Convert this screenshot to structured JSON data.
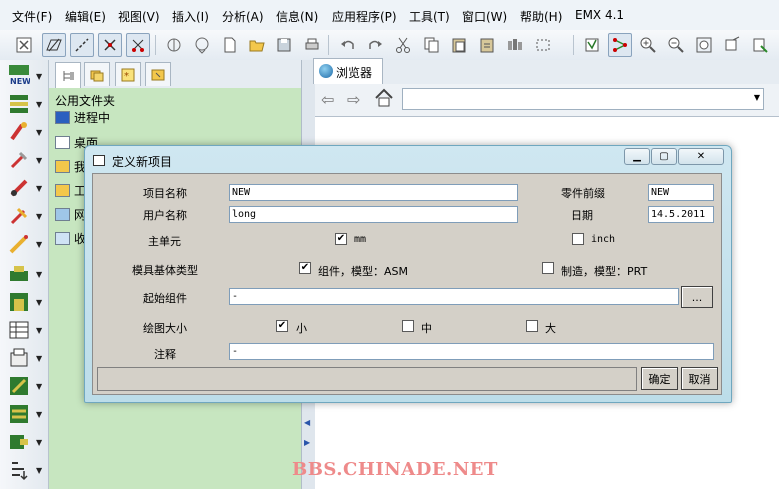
{
  "menu": [
    "文件(F)",
    "编辑(E)",
    "视图(V)",
    "插入(I)",
    "分析(A)",
    "信息(N)",
    "应用程序(P)",
    "工具(T)",
    "窗口(W)",
    "帮助(H)",
    "EMX 4.1"
  ],
  "left_toolbar": {
    "new_label": "NEW"
  },
  "navigator": {
    "folder_title": "公用文件夹",
    "items": [
      "进程中",
      "桌面",
      "我",
      "工",
      "网",
      "收"
    ]
  },
  "browser": {
    "tab_label": "浏览器"
  },
  "dialog": {
    "title": "定义新项目",
    "project_name_label": "项目名称",
    "project_name_value": "NEW",
    "part_prefix_label": "零件前缀",
    "part_prefix_value": "NEW",
    "user_name_label": "用户名称",
    "user_name_value": "long",
    "date_label": "日期",
    "date_value": "14.5.2011",
    "main_unit_label": "主单元",
    "unit_mm": "mm",
    "unit_mm_checked": true,
    "unit_inch": "inch",
    "unit_inch_checked": false,
    "mold_type_label": "模具基体类型",
    "mold_assembly": "组件，模型：ASM",
    "mold_assembly_checked": true,
    "mold_manufacture": "制造，模型：PRT",
    "mold_manufacture_checked": false,
    "start_assembly_label": "起始组件",
    "start_assembly_value": "-",
    "browse_label": "...",
    "drawing_size_label": "绘图大小",
    "size_small": "小",
    "size_small_checked": true,
    "size_medium": "中",
    "size_medium_checked": false,
    "size_large": "大",
    "size_large_checked": false,
    "note_label": "注释",
    "note_value": "-",
    "ok_label": "确定",
    "cancel_label": "取消",
    "check_mark": "✔"
  },
  "watermark": "BBS.CHINADE.NET"
}
